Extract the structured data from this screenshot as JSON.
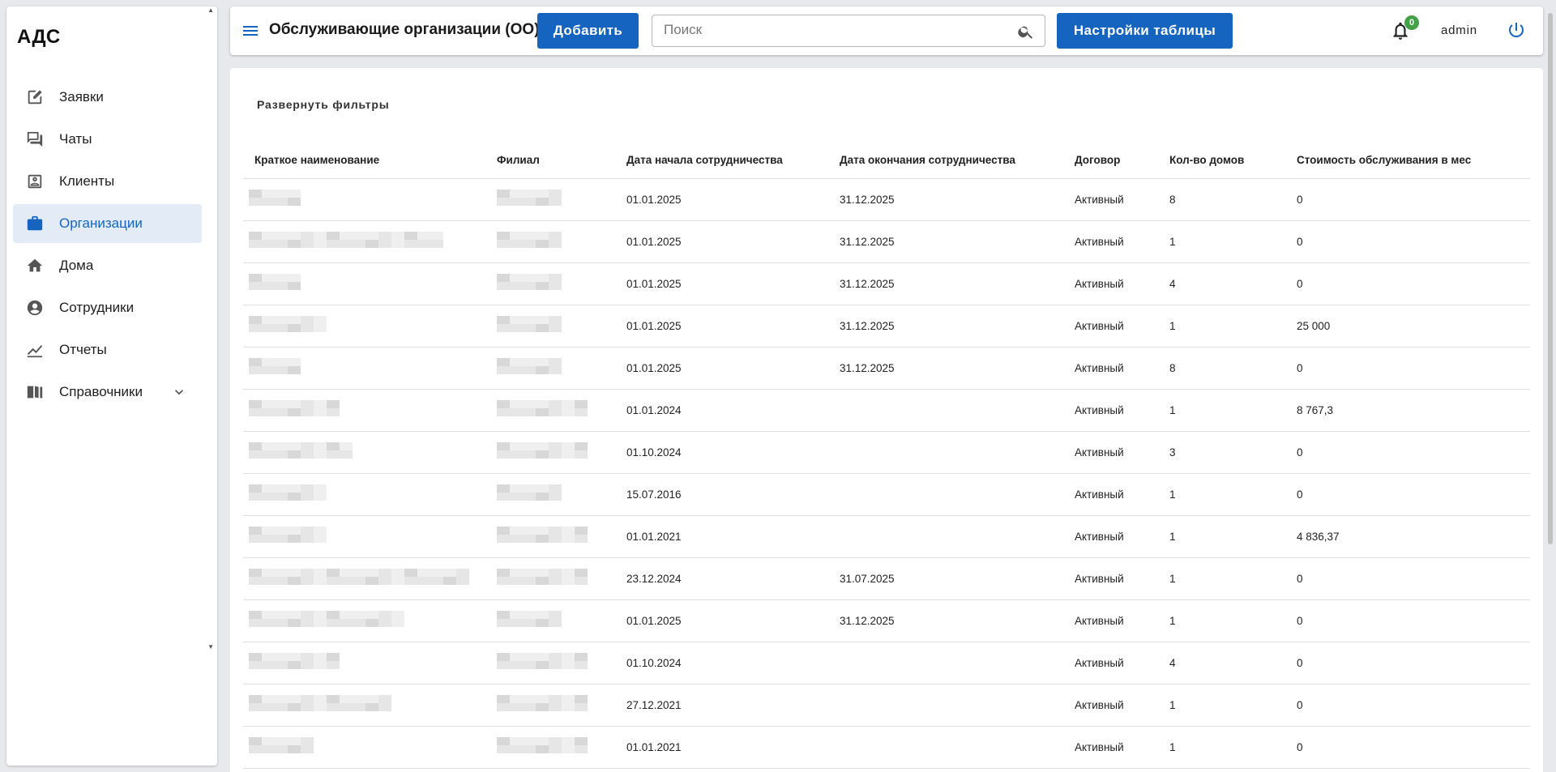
{
  "app": {
    "logo": "АДС"
  },
  "sidebar": {
    "items": [
      {
        "label": "Заявки",
        "icon": "edit-icon"
      },
      {
        "label": "Чаты",
        "icon": "chat-icon"
      },
      {
        "label": "Клиенты",
        "icon": "contact-icon"
      },
      {
        "label": "Организации",
        "icon": "briefcase-icon",
        "active": true
      },
      {
        "label": "Дома",
        "icon": "home-icon"
      },
      {
        "label": "Сотрудники",
        "icon": "account-icon"
      },
      {
        "label": "Отчеты",
        "icon": "chart-line-icon"
      },
      {
        "label": "Справочники",
        "icon": "book-icon"
      }
    ]
  },
  "topbar": {
    "title": "Обслуживающие организации (ОО)",
    "add_label": "Добавить",
    "search_placeholder": "Поиск",
    "search_value": "",
    "settings_label": "Настройки таблицы",
    "notifications_count": "0",
    "username": "admin"
  },
  "main": {
    "filters_toggle": "Развернуть фильтры",
    "columns": [
      "Краткое наименование",
      "Филиал",
      "Дата начала сотрудничества",
      "Дата окончания сотрудничества",
      "Договор",
      "Кол-во домов",
      "Стоимость обслуживания в мес"
    ],
    "rows": [
      {
        "start": "01.01.2025",
        "end": "31.12.2025",
        "contract": "Активный",
        "houses": "8",
        "cost": "0"
      },
      {
        "start": "01.01.2025",
        "end": "31.12.2025",
        "contract": "Активный",
        "houses": "1",
        "cost": "0"
      },
      {
        "start": "01.01.2025",
        "end": "31.12.2025",
        "contract": "Активный",
        "houses": "4",
        "cost": "0"
      },
      {
        "start": "01.01.2025",
        "end": "31.12.2025",
        "contract": "Активный",
        "houses": "1",
        "cost": "25 000"
      },
      {
        "start": "01.01.2025",
        "end": "31.12.2025",
        "contract": "Активный",
        "houses": "8",
        "cost": "0"
      },
      {
        "start": "01.01.2024",
        "end": "",
        "contract": "Активный",
        "houses": "1",
        "cost": "8 767,3"
      },
      {
        "start": "01.10.2024",
        "end": "",
        "contract": "Активный",
        "houses": "3",
        "cost": "0"
      },
      {
        "start": "15.07.2016",
        "end": "",
        "contract": "Активный",
        "houses": "1",
        "cost": "0"
      },
      {
        "start": "01.01.2021",
        "end": "",
        "contract": "Активный",
        "houses": "1",
        "cost": "4 836,37"
      },
      {
        "start": "23.12.2024",
        "end": "31.07.2025",
        "contract": "Активный",
        "houses": "1",
        "cost": "0"
      },
      {
        "start": "01.01.2025",
        "end": "31.12.2025",
        "contract": "Активный",
        "houses": "1",
        "cost": "0"
      },
      {
        "start": "01.10.2024",
        "end": "",
        "contract": "Активный",
        "houses": "4",
        "cost": "0"
      },
      {
        "start": "27.12.2021",
        "end": "",
        "contract": "Активный",
        "houses": "1",
        "cost": "0"
      },
      {
        "start": "01.01.2021",
        "end": "",
        "contract": "Активный",
        "houses": "1",
        "cost": "0"
      }
    ]
  },
  "colors": {
    "accent": "#1565c0",
    "active_bg": "#e3ebf6",
    "badge": "#43a047"
  }
}
